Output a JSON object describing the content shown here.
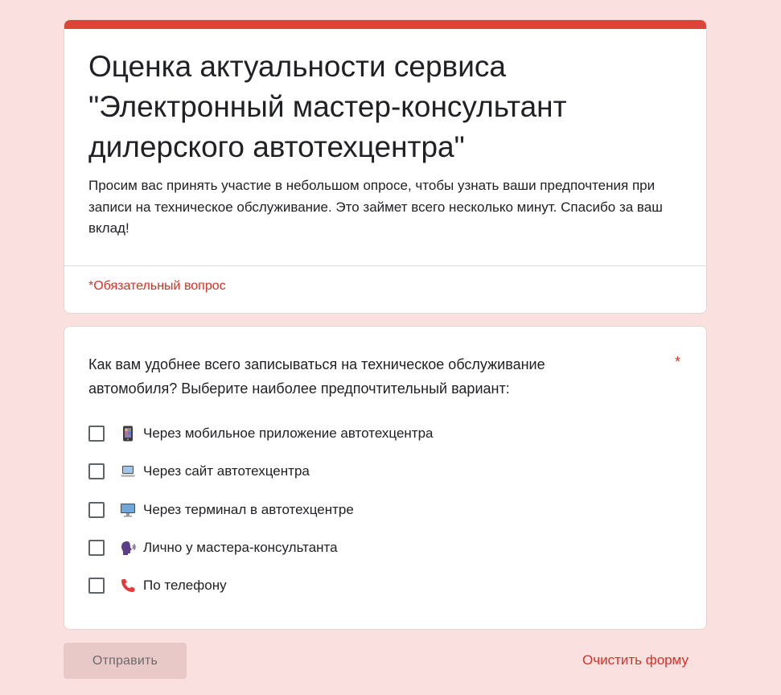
{
  "form": {
    "title": "Оценка актуальности сервиса \"Электронный мастер-консультант дилерского автотехцентра\"",
    "description": "Просим вас принять участие в небольшом опросе, чтобы узнать ваши предпочтения при записи на техническое обслуживание. Это займет всего несколько минут. Спасибо за ваш вклад!",
    "required_note": "*Обязательный вопрос",
    "accent_color": "#db4437",
    "background_color": "#fbe0e0"
  },
  "question": {
    "text": "Как вам удобнее всего записываться на техническое обслуживание автомобиля? Выберите наиболее предпочтительный вариант:",
    "required_mark": "*",
    "options": [
      {
        "icon": "mobile-phone-icon",
        "label": "Через мобильное приложение автотехцентра",
        "checked": false
      },
      {
        "icon": "laptop-icon",
        "label": "Через сайт автотехцентра",
        "checked": false
      },
      {
        "icon": "desktop-monitor-icon",
        "label": "Через терминал в автотехцентре",
        "checked": false
      },
      {
        "icon": "speaking-head-icon",
        "label": "Лично у мастера-консультанта",
        "checked": false
      },
      {
        "icon": "telephone-receiver-icon",
        "label": "По телефону",
        "checked": false
      }
    ]
  },
  "actions": {
    "submit_label": "Отправить",
    "clear_label": "Очистить форму"
  }
}
